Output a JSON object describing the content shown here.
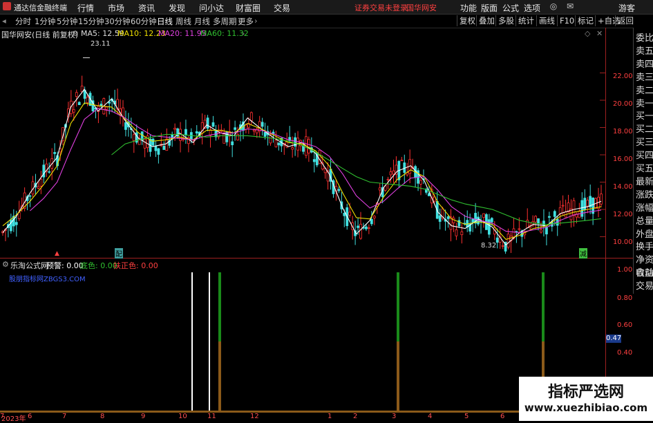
{
  "app": {
    "title": "通达信金融终端",
    "menu": [
      "行情",
      "市场",
      "资讯",
      "发现",
      "问小达",
      "财富圈",
      "交易"
    ],
    "notice": "证券交易未登录",
    "stock_name": "国华网安",
    "right_menu": [
      "功能",
      "版面",
      "公式",
      "选项"
    ],
    "user": "游客"
  },
  "periods": {
    "items": [
      "分时",
      "1分钟",
      "5分钟",
      "15分钟",
      "30分钟",
      "60分钟",
      "日线",
      "周线",
      "月线",
      "多周期",
      "更多"
    ],
    "active": "日线"
  },
  "toolbar_right": [
    "复权",
    "叠加",
    "多股",
    "统计",
    "画线",
    "F10",
    "标记",
    "+自选",
    "返回"
  ],
  "main_chart": {
    "title": "国华网安(日线 前复权)",
    "ma": [
      {
        "label": "MA5: 12.59",
        "color": "#ffffff"
      },
      {
        "label": "MA10: 12.23",
        "color": "#f0e000"
      },
      {
        "label": "MA20: 11.95",
        "color": "#e040e0"
      },
      {
        "label": "MA60: 11.32",
        "color": "#30c030"
      }
    ],
    "high_label": "23.11",
    "low_label": "8.32",
    "yticks": [
      "22.00",
      "20.00",
      "18.00",
      "16.00",
      "14.00",
      "12.00",
      "10.00"
    ],
    "marks": {
      "pi": "配",
      "jian": "减"
    }
  },
  "right_panel": [
    "委比",
    "卖五",
    "卖四",
    "卖三",
    "卖二",
    "卖一",
    "买一",
    "买二",
    "买三",
    "买四",
    "买五",
    "最新",
    "涨跌",
    "涨幅",
    "总量",
    "外盘",
    "换手",
    "净资",
    "收益"
  ],
  "right_panel_bottom": [
    "自动",
    "交易"
  ],
  "sub_chart": {
    "title": "乐淘公式网",
    "items": [
      {
        "label": "预警: 0.00",
        "color": "#ffffff"
      },
      {
        "label": "底色: 0.00",
        "color": "#30c030"
      },
      {
        "label": "扶正色: 0.00",
        "color": "#ff4040"
      }
    ],
    "site": "股朋指标网ZBGS3.COM",
    "yticks": [
      "1.00",
      "0.80",
      "0.60",
      "0.47",
      "0.40"
    ],
    "current": "0.47"
  },
  "xaxis": [
    "2023年",
    "6",
    "7",
    "8",
    "9",
    "10",
    "11",
    "12",
    "1",
    "2",
    "3",
    "4",
    "5",
    "6",
    "7"
  ],
  "watermark": {
    "line1": "指标严选网",
    "line2": "www.xuezhibiao.com"
  },
  "chart_data": {
    "type": "candlestick",
    "series_ma": [
      "MA5",
      "MA10",
      "MA20",
      "MA60"
    ],
    "ma_values": {
      "MA5": 12.59,
      "MA10": 12.23,
      "MA20": 11.95,
      "MA60": 11.32
    },
    "max": 23.11,
    "min": 8.32,
    "ylim": [
      8.0,
      24.0
    ],
    "ma5_path": [
      10.3,
      11.5,
      13.2,
      14.6,
      15.8,
      19.5,
      20.8,
      19.2,
      20.1,
      18.5,
      17.2,
      16.6,
      16.8,
      17.6,
      16.9,
      18.2,
      17.6,
      17.4,
      18.7,
      17.9,
      17.2,
      16.6,
      16.9,
      16.1,
      14.6,
      12.1,
      10.2,
      11.2,
      13.6,
      14.8,
      15.2,
      14.1,
      11.8,
      10.8,
      10.6,
      11.3,
      10.7,
      9.4,
      10.3,
      10.9,
      10.8,
      11.7,
      12.0,
      12.2,
      12.6
    ],
    "ma10_path": [
      10.8,
      11.6,
      12.6,
      13.8,
      15.2,
      18.3,
      19.8,
      19.6,
      19.5,
      18.6,
      17.6,
      17.0,
      17.1,
      17.3,
      17.1,
      17.8,
      17.8,
      17.6,
      18.3,
      17.9,
      17.4,
      16.9,
      16.8,
      16.3,
      15.2,
      13.2,
      11.4,
      11.3,
      12.9,
      14.2,
      14.9,
      14.4,
      12.5,
      11.3,
      10.9,
      11.1,
      10.9,
      9.8,
      10.1,
      10.6,
      10.8,
      11.5,
      11.8,
      12.0,
      12.2
    ],
    "ma20_path": [
      null,
      null,
      11.9,
      12.8,
      14.0,
      16.4,
      18.6,
      19.4,
      19.2,
      18.7,
      18.0,
      17.4,
      17.3,
      17.2,
      17.1,
      17.4,
      17.6,
      17.6,
      17.9,
      17.8,
      17.5,
      17.1,
      16.9,
      16.6,
      15.9,
      14.6,
      13.0,
      12.1,
      12.6,
      13.5,
      14.3,
      14.4,
      13.4,
      12.2,
      11.5,
      11.2,
      11.0,
      10.4,
      10.3,
      10.5,
      10.7,
      11.2,
      11.6,
      11.8,
      11.95
    ],
    "ma60_path": [
      null,
      null,
      null,
      null,
      null,
      null,
      null,
      null,
      16.0,
      16.8,
      17.1,
      17.3,
      17.5,
      17.5,
      17.4,
      17.3,
      17.4,
      17.4,
      17.4,
      17.3,
      17.2,
      17.0,
      16.7,
      16.2,
      15.6,
      15.0,
      14.4,
      14.0,
      13.9,
      13.8,
      13.7,
      13.5,
      13.1,
      12.7,
      12.4,
      12.2,
      12.0,
      11.6,
      11.2,
      11.0,
      10.9,
      11.0,
      11.1,
      11.2,
      11.32
    ]
  }
}
